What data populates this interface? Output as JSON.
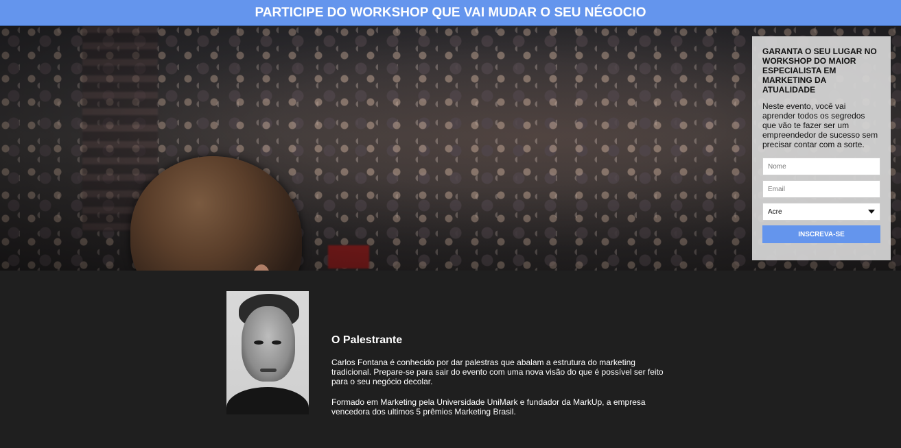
{
  "header": {
    "title": "PARTICIPE DO WORKSHOP QUE VAI MUDAR O SEU NÉGOCIO"
  },
  "signup_form": {
    "title": "GARANTA O SEU LUGAR NO WORKSHOP DO MAIOR ESPECIALISTA EM MARKETING DA ATUALIDADE",
    "description": "Neste evento, você vai aprender todos os segredos que vão te fazer ser um empreendedor de sucesso sem precisar contar com a sorte.",
    "name_placeholder": "Nome",
    "email_placeholder": "Email",
    "state_selected": "Acre",
    "submit_label": "INSCREVA-SE"
  },
  "speaker": {
    "heading": "O Palestrante",
    "bio_1": "Carlos Fontana é conhecido por dar palestras que abalam a estrutura do marketing tradicional. Prepare-se para sair do evento com uma nova visão do que é possível ser feito para o seu negócio decolar.",
    "bio_2": "Formado em Marketing pela Universidade UniMark e fundador da MarkUp, a empresa vencedora dos ultimos 5 prêmios Marketing Brasil."
  },
  "colors": {
    "accent": "#6495ed",
    "dark_background": "#1f1f1f",
    "panel_background": "#d6d6d6"
  }
}
